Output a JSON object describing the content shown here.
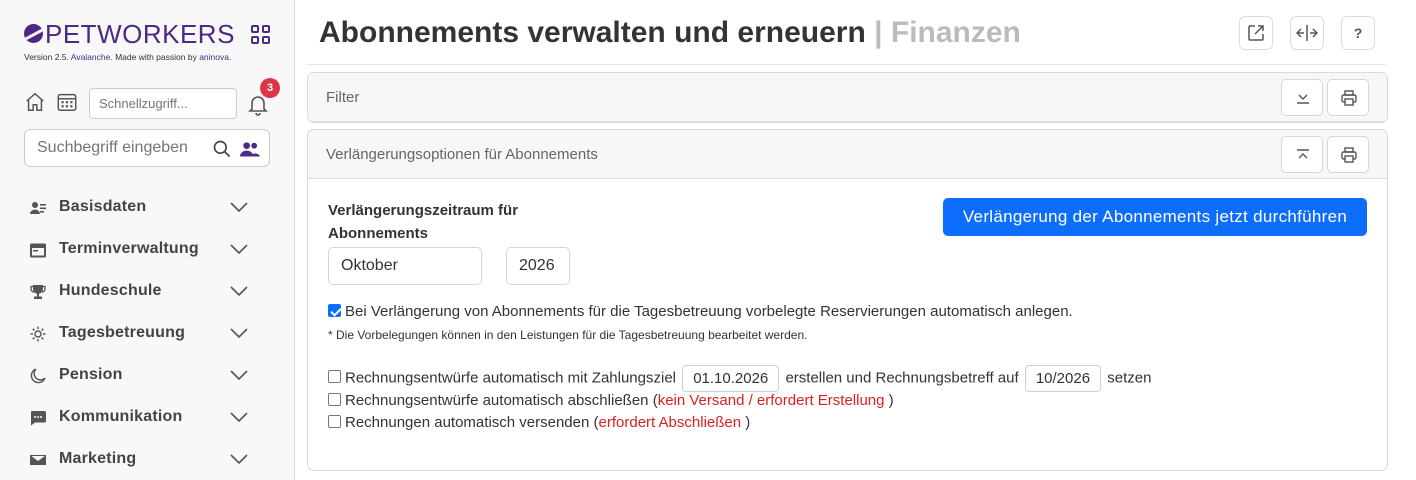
{
  "brand": {
    "name": "PETWORKERS",
    "version_prefix": "Version 2.5.",
    "version_name": "Avalanche.",
    "version_suffix": "Made with passion by",
    "maker": "aninova."
  },
  "quick": {
    "placeholder": "Schnellzugriff...",
    "notification_count": "3"
  },
  "search": {
    "placeholder": "Suchbegriff eingeben"
  },
  "sidebar": {
    "items": [
      {
        "label": "Basisdaten",
        "icon": "id-card-icon"
      },
      {
        "label": "Terminverwaltung",
        "icon": "calendar-card-icon"
      },
      {
        "label": "Hundeschule",
        "icon": "trophy-icon"
      },
      {
        "label": "Tagesbetreuung",
        "icon": "sun-icon"
      },
      {
        "label": "Pension",
        "icon": "moon-icon"
      },
      {
        "label": "Kommunikation",
        "icon": "chat-icon"
      },
      {
        "label": "Marketing",
        "icon": "envelope-icon"
      }
    ]
  },
  "header": {
    "title": "Abonnements verwalten und erneuern",
    "separator": "|",
    "section": "Finanzen",
    "help_label": "?"
  },
  "filter_card": {
    "title": "Filter"
  },
  "renewal_card": {
    "title": "Verlängerungsoptionen für Abonnements",
    "period_label": "Verlängerungszeitraum für Abonnements",
    "month": "Oktober",
    "year": "2026",
    "run_button": "Verlängerung der Abonnements jetzt durchführen",
    "reservations_checkbox": {
      "checked": true,
      "label": "Bei Verlängerung von Abonnements für die Tagesbetreuung vorbelegte Reservierungen automatisch anlegen."
    },
    "note": "* Die Vorbelegungen können in den Leistungen für die Tagesbetreuung bearbeitet werden.",
    "invoice_drafts": {
      "checked": false,
      "label_before": "Rechnungsentwürfe automatisch mit Zahlungsziel",
      "due_date": "01.10.2026",
      "label_middle": "erstellen und Rechnungsbetreff auf",
      "subject_period": "10/2026",
      "label_after": "setzen"
    },
    "close_drafts": {
      "checked": false,
      "label": "Rechnungsentwürfe automatisch abschließen",
      "open": "(",
      "warning": "kein Versand / erfordert Erstellung",
      "close": ")"
    },
    "send_invoices": {
      "checked": false,
      "label": "Rechnungen automatisch versenden",
      "open": "(",
      "warning": "erfordert Abschließen",
      "close": ")"
    }
  },
  "colors": {
    "brand": "#4c2a83",
    "primary": "#0d6efd",
    "danger": "#dc1f1f",
    "badge": "#dc3545"
  }
}
